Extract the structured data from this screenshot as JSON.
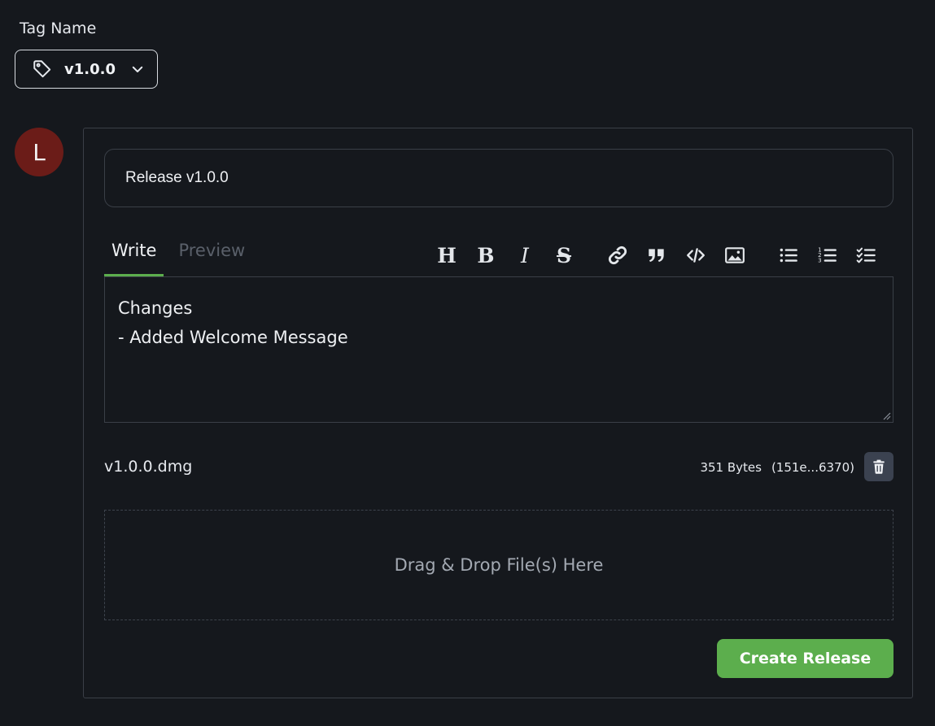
{
  "tag": {
    "label": "Tag Name",
    "selected": "v1.0.0",
    "icon": "tag-icon",
    "chevron_icon": "chevron-down-icon"
  },
  "avatar": {
    "initial": "L",
    "color": "#6b1c18"
  },
  "release": {
    "title_value": "Release v1.0.0"
  },
  "editor": {
    "tabs": [
      {
        "label": "Write",
        "active": true
      },
      {
        "label": "Preview",
        "active": false
      }
    ],
    "toolbar": [
      {
        "name": "heading-icon",
        "glyph": "H"
      },
      {
        "name": "bold-icon",
        "glyph": "B"
      },
      {
        "name": "italic-icon",
        "glyph": "I"
      },
      {
        "name": "strikethrough-icon",
        "glyph": "S"
      },
      {
        "name": "link-icon"
      },
      {
        "name": "quote-icon"
      },
      {
        "name": "code-icon"
      },
      {
        "name": "image-icon"
      },
      {
        "name": "bulleted-list-icon"
      },
      {
        "name": "numbered-list-icon"
      },
      {
        "name": "task-list-icon"
      }
    ],
    "content_lines": [
      "Changes",
      "- Added Welcome Message"
    ]
  },
  "attachment": {
    "file_name": "v1.0.0.dmg",
    "size": "351 Bytes",
    "hash": "(151e...6370)",
    "delete_icon": "trash-icon"
  },
  "dropzone": {
    "text": "Drag & Drop File(s) Here"
  },
  "actions": {
    "create_label": "Create Release"
  },
  "colors": {
    "background": "#15181d",
    "accent": "#5cae4d",
    "border": "#3a3f47"
  }
}
